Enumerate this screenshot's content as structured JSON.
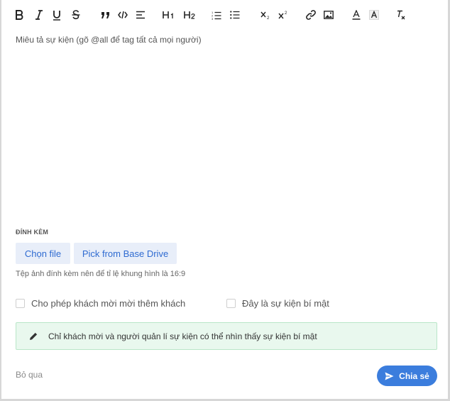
{
  "toolbar": {
    "buttons": [
      {
        "name": "bold-icon",
        "glyph": "B"
      },
      {
        "name": "italic-icon",
        "glyph": "I"
      },
      {
        "name": "underline-icon",
        "glyph": "U"
      },
      {
        "name": "strikethrough-icon",
        "glyph": "S"
      },
      {
        "name": "blockquote-icon",
        "glyph": "99"
      },
      {
        "name": "code-icon",
        "glyph": "</>"
      },
      {
        "name": "align-icon",
        "glyph": "align"
      },
      {
        "name": "heading-1-icon",
        "glyph": "H1"
      },
      {
        "name": "heading-2-icon",
        "glyph": "H2"
      },
      {
        "name": "ordered-list-icon",
        "glyph": "ol"
      },
      {
        "name": "bullet-list-icon",
        "glyph": "ul"
      },
      {
        "name": "subscript-icon",
        "glyph": "x2"
      },
      {
        "name": "superscript-icon",
        "glyph": "x2"
      },
      {
        "name": "link-icon",
        "glyph": "link"
      },
      {
        "name": "image-icon",
        "glyph": "img"
      },
      {
        "name": "text-color-icon",
        "glyph": "A"
      },
      {
        "name": "background-color-icon",
        "glyph": "A"
      },
      {
        "name": "clear-format-icon",
        "glyph": "Tx"
      }
    ]
  },
  "editor": {
    "placeholder": "Miêu tả sự kiện (gõ @all để tag tất cả mọi người)"
  },
  "attachments": {
    "label": "ĐÍNH KÈM",
    "choose_file": "Chọn file",
    "pick_drive": "Pick from Base Drive",
    "hint": "Tệp ảnh đính kèm nên để tỉ lệ khung hình là 16:9"
  },
  "options": {
    "allow_guests": "Cho phép khách mời mời thêm khách",
    "secret_event": "Đây là sự kiện bí mật"
  },
  "notice": {
    "text": "Chỉ khách mời và người quản lí sự kiện có thể nhìn thấy sự kiện bí mật",
    "background": "#e9f8ee"
  },
  "footer": {
    "skip": "Bỏ qua",
    "share": "Chia sẻ"
  },
  "colors": {
    "accent": "#3b7ddd",
    "soft_button_bg": "#e8eef9",
    "soft_button_text": "#2f6bd1"
  }
}
